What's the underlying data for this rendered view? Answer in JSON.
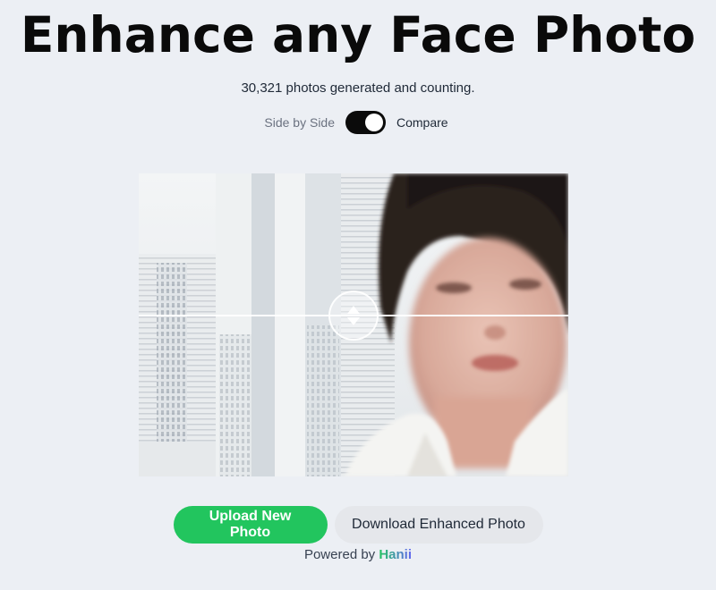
{
  "header": {
    "title": "Enhance any Face Photo",
    "subtitle": "30,321 photos generated and counting."
  },
  "view_toggle": {
    "left_label": "Side by Side",
    "right_label": "Compare",
    "state": "compare"
  },
  "compare_viewer": {
    "image_description_icon": "portrait-photo",
    "slider_icon": "vertical-arrows-icon"
  },
  "actions": {
    "upload_label": "Upload New Photo",
    "download_label": "Download Enhanced Photo"
  },
  "footer": {
    "powered_prefix": "Powered by",
    "brand": "Hanii"
  },
  "colors": {
    "background": "#eceff4",
    "upload_button": "#22c55e",
    "download_button": "#e5e7eb",
    "toggle_on": "#0b0b0b"
  }
}
